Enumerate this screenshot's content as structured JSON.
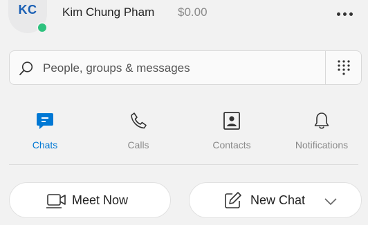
{
  "profile": {
    "initials": "KC",
    "name": "Kim Chung Pham",
    "credit": "$0.00",
    "presence_color": "#2ec27e",
    "more_icon": "more-horizontal-icon"
  },
  "search": {
    "placeholder": "People, groups & messages",
    "icon": "search-icon",
    "dialpad_icon": "dialpad-icon"
  },
  "nav": {
    "items": [
      {
        "label": "Chats",
        "icon": "chat-icon",
        "active": true
      },
      {
        "label": "Calls",
        "icon": "phone-icon",
        "active": false
      },
      {
        "label": "Contacts",
        "icon": "contacts-icon",
        "active": false
      },
      {
        "label": "Notifications",
        "icon": "bell-icon",
        "active": false
      }
    ]
  },
  "actions": {
    "meet_now": "Meet Now",
    "new_chat": "New Chat"
  },
  "colors": {
    "accent": "#0078d4",
    "background": "#f2f2f2"
  }
}
